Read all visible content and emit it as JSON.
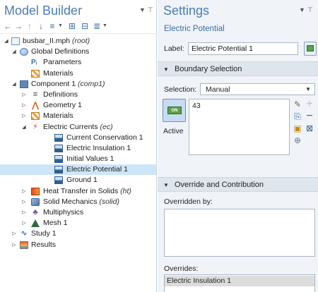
{
  "model_builder": {
    "title": "Model Builder",
    "tree": [
      {
        "label": "busbar_II.mph",
        "suffix": "(root)"
      },
      {
        "label": "Global Definitions",
        "suffix": ""
      },
      {
        "label": "Parameters",
        "suffix": ""
      },
      {
        "label": "Materials",
        "suffix": ""
      },
      {
        "label": "Component 1",
        "suffix": "(comp1)"
      },
      {
        "label": "Definitions",
        "suffix": ""
      },
      {
        "label": "Geometry 1",
        "suffix": ""
      },
      {
        "label": "Materials",
        "suffix": ""
      },
      {
        "label": "Electric Currents",
        "suffix": "(ec)"
      },
      {
        "label": "Current Conservation 1",
        "suffix": ""
      },
      {
        "label": "Electric Insulation 1",
        "suffix": ""
      },
      {
        "label": "Initial Values 1",
        "suffix": ""
      },
      {
        "label": "Electric Potential 1",
        "suffix": ""
      },
      {
        "label": "Ground 1",
        "suffix": ""
      },
      {
        "label": "Heat Transfer in Solids",
        "suffix": "(ht)"
      },
      {
        "label": "Solid Mechanics",
        "suffix": "(solid)"
      },
      {
        "label": "Multiphysics",
        "suffix": ""
      },
      {
        "label": "Mesh 1",
        "suffix": ""
      },
      {
        "label": "Study 1",
        "suffix": ""
      },
      {
        "label": "Results",
        "suffix": ""
      }
    ]
  },
  "settings": {
    "title": "Settings",
    "subtitle": "Electric Potential",
    "label_caption": "Label:",
    "label_value": "Electric Potential 1",
    "boundary_section": "Boundary Selection",
    "selection_caption": "Selection:",
    "selection_value": "Manual",
    "active_label": "Active",
    "active_toggle": "ON",
    "selected_items": [
      "43"
    ],
    "override_section": "Override and Contribution",
    "overridden_by_caption": "Overridden by:",
    "overrides_caption": "Overrides:",
    "overrides_items": [
      "Electric Insulation 1"
    ]
  },
  "icons": {
    "toolbar": [
      "back-arrow-icon",
      "forward-arrow-icon",
      "up-arrow-icon",
      "down-arrow-icon",
      "show-menu-icon",
      "expand-all-icon",
      "collapse-all-icon",
      "more-menu-icon"
    ],
    "selection_side": [
      "paste-icon",
      "copy-icon",
      "clear-icon",
      "zoom-icon",
      "add-icon",
      "remove-icon",
      "move-icon"
    ]
  },
  "colors": {
    "title_blue": "#4a7db8",
    "selected_row": "#cde6f7",
    "section_bg": "#dfe5ec",
    "panel_bg": "#f0f3f7"
  }
}
